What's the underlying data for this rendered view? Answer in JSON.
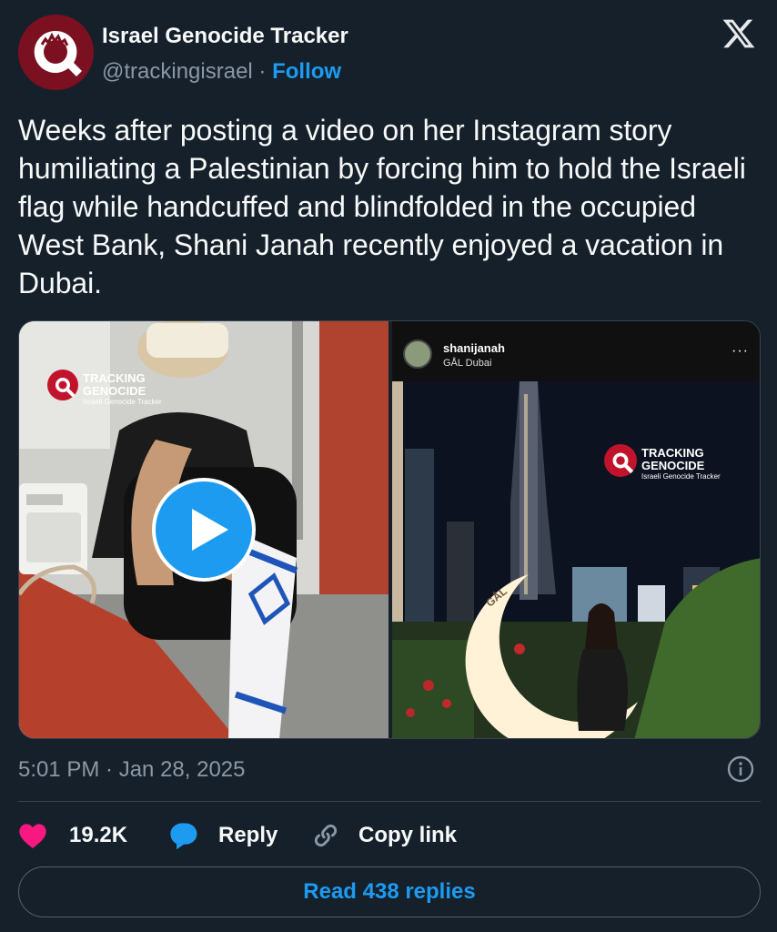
{
  "author": {
    "name": "Israel Genocide Tracker",
    "handle": "@trackingisrael",
    "separator": "·",
    "follow_label": "Follow"
  },
  "tweet": {
    "text": "Weeks after posting a video on her Instagram story humiliating a Palestinian by forcing him to hold the Israeli flag while handcuffed and blindfolded in the occupied West Bank, Shani Janah recently enjoyed a vacation in Dubai.",
    "timestamp": "5:01 PM · Jan 28, 2025"
  },
  "media": {
    "watermark_line1": "TRACKING",
    "watermark_line2": "GENOCIDE",
    "watermark_sub": "Israeli Genocide Tracker",
    "instagram": {
      "username": "shanijanah",
      "location": "GÅL Dubai",
      "more": "···"
    },
    "crescent_text": "GÅL"
  },
  "actions": {
    "like_count": "19.2K",
    "reply_label": "Reply",
    "copy_label": "Copy link"
  },
  "read_replies_label": "Read 438 replies",
  "colors": {
    "background": "#15202b",
    "accent": "#1d9bf0",
    "like": "#f91880",
    "secondary_text": "#8b98a5",
    "border": "#38444d"
  },
  "icons": {
    "brand": "x-logo-icon",
    "info": "info-icon",
    "like": "heart-icon",
    "reply": "reply-bubble-icon",
    "copy": "link-icon",
    "play": "play-icon"
  }
}
